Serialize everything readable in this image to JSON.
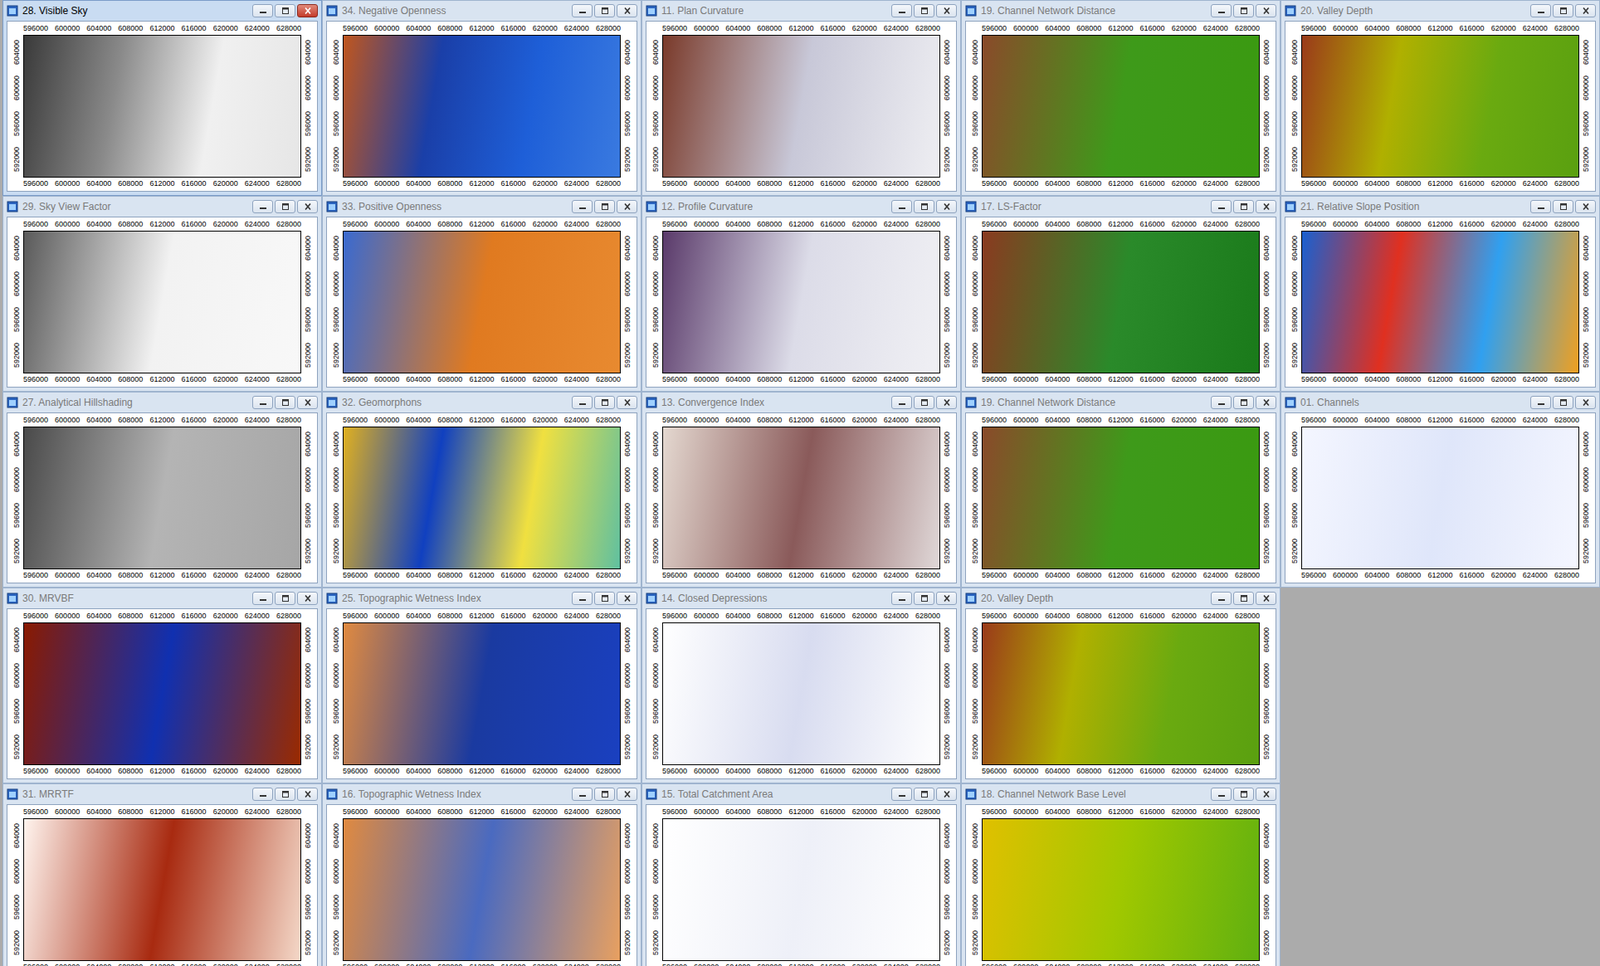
{
  "desktop": {
    "windows": [
      {
        "title": "28. Visible Sky",
        "active": true,
        "colors": [
          "#3a3a3a",
          "#8a8a8a",
          "#f0f0f0",
          "#e6e6e6"
        ]
      },
      {
        "title": "29. Sky View Factor",
        "active": false,
        "colors": [
          "#5a5a5a",
          "#f2f2f2",
          "#f8f8f8"
        ]
      },
      {
        "title": "27. Analytical Hillshading",
        "active": false,
        "colors": [
          "#4a4a4a",
          "#b4b4b4",
          "#a6a6a6"
        ]
      },
      {
        "title": "30. MRVBF",
        "active": false,
        "colors": [
          "#8a1a00",
          "#1030b0",
          "#9a2a00"
        ]
      },
      {
        "title": "31. MRRTF",
        "active": false,
        "colors": [
          "#fff4ee",
          "#a82a10",
          "#f4d8c8"
        ]
      },
      {
        "title": "34. Negative Openness",
        "active": false,
        "colors": [
          "#c0561e",
          "#1a3fa8",
          "#1e5fd8",
          "#3a7ae0"
        ]
      },
      {
        "title": "33. Positive Openness",
        "active": false,
        "colors": [
          "#3a6ad0",
          "#e07a20",
          "#e88a30"
        ]
      },
      {
        "title": "32. Geomorphons",
        "active": false,
        "colors": [
          "#e0b020",
          "#1040c0",
          "#f0e040",
          "#60c0a0"
        ]
      },
      {
        "title": "25. Topographic Wetness Index",
        "active": false,
        "colors": [
          "#e08a40",
          "#1a3aa0",
          "#1a40c0"
        ]
      },
      {
        "title": "16. Topographic Wetness Index",
        "active": false,
        "colors": [
          "#e08a40",
          "#4a6ac0",
          "#e8a060"
        ]
      },
      {
        "title": "11. Plan Curvature",
        "active": false,
        "colors": [
          "#7a3a2a",
          "#c8c8d8",
          "#eeeef2"
        ]
      },
      {
        "title": "12. Profile Curvature",
        "active": false,
        "colors": [
          "#5a3a6a",
          "#dcdce8",
          "#f0f0f4"
        ]
      },
      {
        "title": "13. Convergence Index",
        "active": false,
        "colors": [
          "#e4d8d0",
          "#8a5a5a",
          "#e0d8d8"
        ]
      },
      {
        "title": "14. Closed Depressions",
        "active": false,
        "colors": [
          "#ffffff",
          "#d8dcf0",
          "#ffffff"
        ]
      },
      {
        "title": "15. Total Catchment Area",
        "active": false,
        "colors": [
          "#ffffff",
          "#eef0f8",
          "#ffffff"
        ]
      },
      {
        "title": "19. Channel Network Distance",
        "active": false,
        "colors": [
          "#8a4a2a",
          "#3e9a1a",
          "#3a9a10"
        ]
      },
      {
        "title": "17. LS-Factor",
        "active": false,
        "colors": [
          "#8a3a20",
          "#2a8a2a",
          "#1a7a1a"
        ]
      },
      {
        "title": "19. Channel Network Distance",
        "active": false,
        "colors": [
          "#8a4a2a",
          "#3e9a1a",
          "#3a9a10"
        ]
      },
      {
        "title": "20. Valley Depth",
        "active": false,
        "colors": [
          "#9a3a1a",
          "#b0b000",
          "#6aaa10",
          "#5aa010"
        ]
      },
      {
        "title": "18. Channel Network Base Level",
        "active": false,
        "colors": [
          "#e0c000",
          "#a0c800",
          "#60b010"
        ]
      },
      {
        "title": "20. Valley Depth",
        "active": false,
        "colors": [
          "#9a3a1a",
          "#b0b000",
          "#6aaa10",
          "#5aa010"
        ]
      },
      {
        "title": "21. Relative Slope Position",
        "active": false,
        "colors": [
          "#1a60d0",
          "#e03020",
          "#30a0f0",
          "#f0a020"
        ]
      },
      {
        "title": "01. Channels",
        "active": false,
        "colors": [
          "#f4f6ff",
          "#dfe6fa",
          "#f4f6ff"
        ]
      }
    ]
  },
  "axes": {
    "x_ticks": [
      "596000",
      "600000",
      "604000",
      "608000",
      "612000",
      "616000",
      "620000",
      "624000",
      "628000"
    ],
    "y_ticks": [
      "604000",
      "600000",
      "596000",
      "592000"
    ]
  }
}
